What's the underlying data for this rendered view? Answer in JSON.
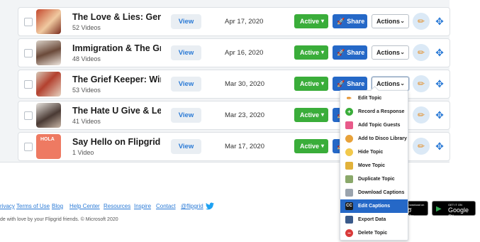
{
  "rows": [
    {
      "title": "The Love & Lies: Gen Z",
      "subtitle": "52 Videos",
      "date": "Apr 17, 2020"
    },
    {
      "title": "Immigration & The Grief Ke...",
      "subtitle": "48 Videos",
      "date": "Apr 16, 2020"
    },
    {
      "title": "The Grief Keeper: Window ...",
      "subtitle": "53 Videos",
      "date": "Mar 30, 2020"
    },
    {
      "title": "The Hate U Give & Letter to...",
      "subtitle": "41 Videos",
      "date": "Mar 23, 2020"
    },
    {
      "title": "Say Hello on Flipgrid!",
      "subtitle": "1 Video",
      "date": "Mar 17, 2020"
    }
  ],
  "labels": {
    "view": "View",
    "active": "Active",
    "share": "Share",
    "actions": "Actions",
    "thumb5_text": "HOLA"
  },
  "menu": [
    {
      "label": "Edit Topic",
      "icon": "pencil-icon"
    },
    {
      "label": "Record a Response",
      "icon": "plus-circle-icon"
    },
    {
      "label": "Add Topic Guests",
      "icon": "ticket-icon"
    },
    {
      "label": "Add to Disco Library",
      "icon": "disco-icon"
    },
    {
      "label": "Hide Topic",
      "icon": "hide-face-icon"
    },
    {
      "label": "Move Topic",
      "icon": "truck-icon"
    },
    {
      "label": "Duplicate Topic",
      "icon": "duplicate-icon"
    },
    {
      "label": "Download Captions",
      "icon": "download-icon"
    },
    {
      "label": "Edit Captions",
      "icon": "cc-icon"
    },
    {
      "label": "Export Data",
      "icon": "floppy-icon"
    },
    {
      "label": "Delete Topic",
      "icon": "delete-icon"
    }
  ],
  "footer": {
    "links": [
      "rivacy",
      "Terms of Use",
      "Blog",
      "Help Center",
      "Resources",
      "Inspire",
      "Contact",
      "@flipgrid"
    ],
    "copyright": "de with love by your Flipgrid friends. © Microsoft 2020",
    "app_store": {
      "small": "Download on the",
      "big": "p Store"
    },
    "google_play": {
      "small": "GET IT ON",
      "big": "Google Play"
    }
  },
  "colors": {
    "active": "#3aad3a",
    "share": "#2568c7",
    "link": "#2a7ad6",
    "highlight": "#2568c7"
  }
}
